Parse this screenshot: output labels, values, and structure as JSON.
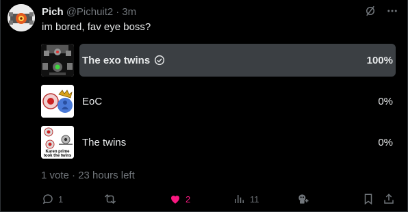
{
  "post": {
    "author_name": "Pich",
    "author_handle": "@Pichuit2",
    "separator": "·",
    "time": "3m",
    "text": "im bored, fav eye boss?"
  },
  "poll": {
    "options": [
      {
        "label": "The exo twins",
        "percent": "100%",
        "fraction": 1.0,
        "winner": true,
        "thumb_icon": "exo-twins-thumbnail"
      },
      {
        "label": "EoC",
        "percent": "0%",
        "fraction": 0.0,
        "winner": false,
        "thumb_icon": "eye-of-cthulhu-thumbnail"
      },
      {
        "label": "The twins",
        "percent": "0%",
        "fraction": 0.0,
        "winner": false,
        "thumb_icon": "the-twins-thumbnail",
        "thumb_text": "Karen prime took the twins"
      }
    ],
    "meta": "1 vote · 23 hours left"
  },
  "actions": {
    "reply_count": "1",
    "repost_count": "",
    "like_count": "2",
    "views_count": "11",
    "grok_icon": "grok-icon",
    "bookmark_icon": "bookmark-icon",
    "share_icon": "share-icon"
  },
  "colors": {
    "background": "#000000",
    "text": "#e7e9ea",
    "muted": "#71767b",
    "bar": "#3b3f43",
    "like": "#f91880"
  }
}
